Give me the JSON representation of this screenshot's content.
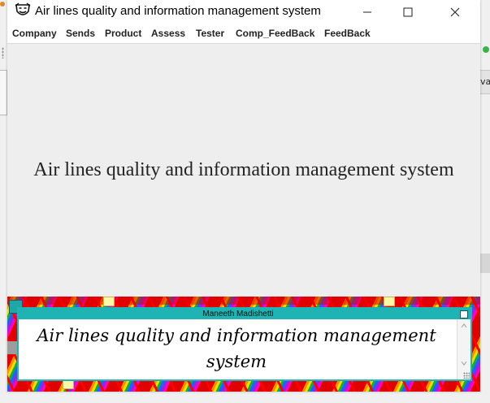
{
  "window": {
    "title": "Air lines quality and information management system",
    "icons": {
      "app": "theatre-mask-icon",
      "minimize": "minimize-icon",
      "maximize": "maximize-icon",
      "close": "close-icon"
    }
  },
  "menu": [
    "Company",
    "Sends",
    "Product",
    "Assess",
    "Tester",
    "Comp_FeedBack",
    "FeedBack"
  ],
  "main": {
    "heading": "Air lines quality and information management system"
  },
  "banner": {
    "name": "Maneeth Madishetti",
    "text": "Air lines quality and information management system"
  },
  "background_app": {
    "right_strip_text": "va"
  },
  "colors": {
    "banner_teal": "#1fb3b3",
    "footer_red": "#e00000",
    "window_bg": "#eeeeee"
  }
}
